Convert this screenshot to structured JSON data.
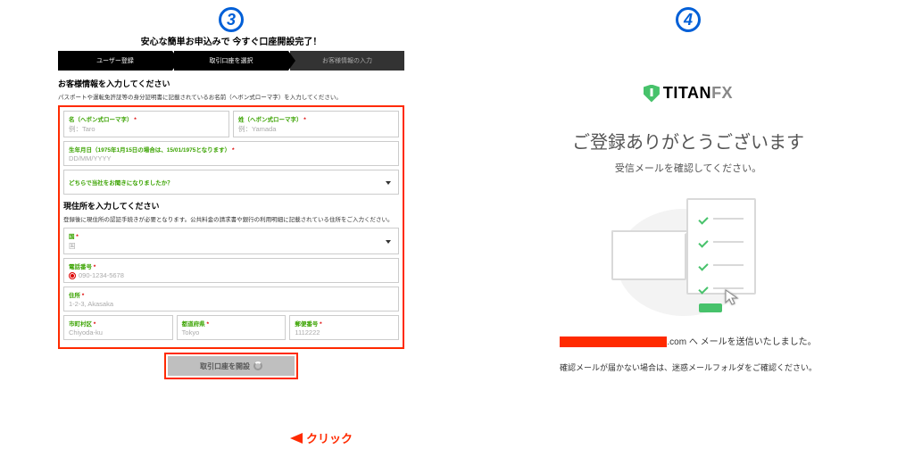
{
  "step_left": "3",
  "step_right": "4",
  "left": {
    "headline": "安心な簡単お申込みで 今すぐ口座開設完了！",
    "progress": [
      "ユーザー登録",
      "取引口座を選択",
      "お客様情報の入力"
    ],
    "custinfo_title": "お客様情報を入力してください",
    "custinfo_sub": "パスポートや運転免許証等の身分証明書に記載されているお名前（ヘボン式ローマ字）を入力してください。",
    "fields": {
      "first": {
        "label": "名（ヘボン式ローマ字）",
        "ph": "例：Taro"
      },
      "last": {
        "label": "姓（ヘボン式ローマ字）",
        "ph": "例：Yamada"
      },
      "dob": {
        "label": "生年月日（1975年1月15日の場合は、15/01/1975となります）",
        "ph": "DD/MM/YYYY"
      },
      "hear": {
        "label": "どちらで当社をお聞きになりましたか？"
      }
    },
    "address_title": "現住所を入力してください",
    "address_sub": "登録後に現住所の認証手続きが必要となります。公共料金の請求書や銀行の利用明細に記載されている住所をご入力ください。",
    "addr": {
      "country": {
        "label": "国",
        "ph": "国"
      },
      "phone": {
        "label": "電話番号",
        "ph": "090-1234-5678"
      },
      "addrline": {
        "label": "住所",
        "ph": "1-2-3, Akasaka"
      },
      "city": {
        "label": "市町村区",
        "ph": "Chiyoda-ku"
      },
      "state": {
        "label": "都道府県",
        "ph": "Tokyo"
      },
      "zip": {
        "label": "郵便番号",
        "ph": "1112222"
      }
    },
    "submit": "取引口座を開設",
    "click_label": "クリック"
  },
  "right": {
    "brand_a": "TITAN",
    "brand_b": "FX",
    "thanks": "ご登録ありがとうございます",
    "thanks_sub": "受信メールを確認してください。",
    "sent_suffix": ".com へ メールを送信いたしました。",
    "note": "確認メールが届かない場合は、迷惑メールフォルダをご確認ください。"
  }
}
